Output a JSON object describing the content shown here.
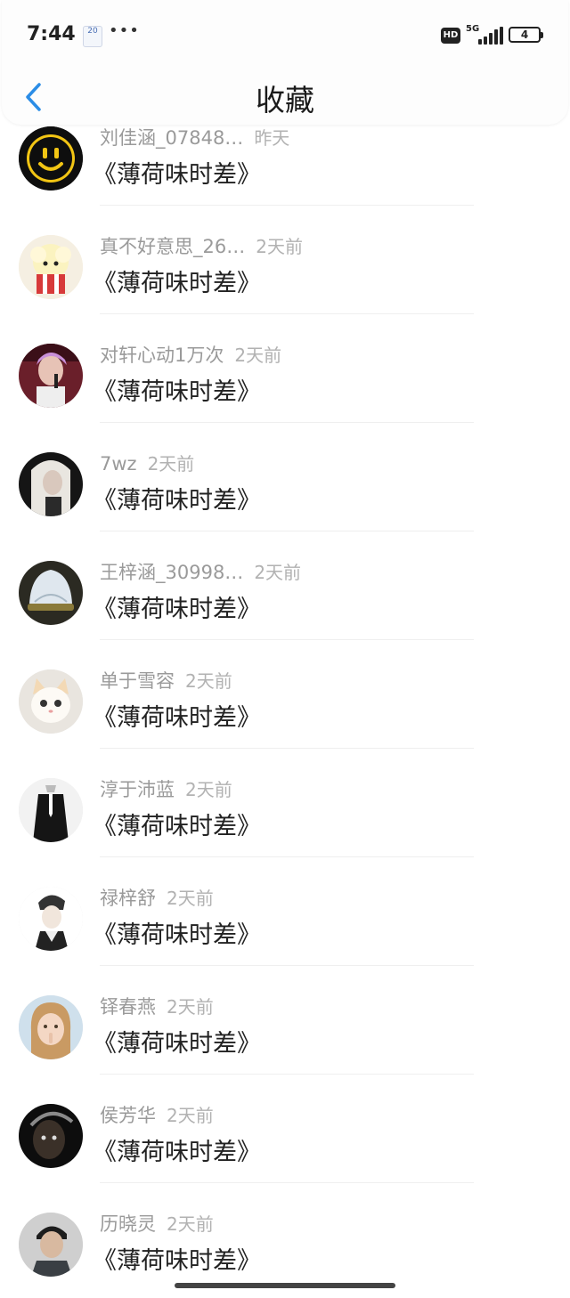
{
  "status_bar": {
    "time": "7:44",
    "date_badge": "20",
    "more": "•••",
    "hd": "HD",
    "network": "5G",
    "battery": "4"
  },
  "nav": {
    "back_icon": "chevron-left-icon",
    "title": "收藏",
    "accent_color": "#2b8de6"
  },
  "list": {
    "items": [
      {
        "name": "刘佳涵_07848…",
        "time": "昨天",
        "book": "《薄荷味时差》",
        "avatar": "smiley-face"
      },
      {
        "name": "真不好意思_26…",
        "time": "2天前",
        "book": "《薄荷味时差》",
        "avatar": "popcorn-cartoon"
      },
      {
        "name": "对轩心动1万次",
        "time": "2天前",
        "book": "《薄荷味时差》",
        "avatar": "singer-photo"
      },
      {
        "name": "7wz",
        "time": "2天前",
        "book": "《薄荷味时差》",
        "avatar": "girl-photo"
      },
      {
        "name": "王梓涵_30998…",
        "time": "2天前",
        "book": "《薄荷味时差》",
        "avatar": "crystal-object"
      },
      {
        "name": "单于雪容",
        "time": "2天前",
        "book": "《薄荷味时差》",
        "avatar": "kitten"
      },
      {
        "name": "淳于沛蓝",
        "time": "2天前",
        "book": "《薄荷味时差》",
        "avatar": "suit-figure"
      },
      {
        "name": "禄梓舒",
        "time": "2天前",
        "book": "《薄荷味时差》",
        "avatar": "sketch-figure"
      },
      {
        "name": "铎春燕",
        "time": "2天前",
        "book": "《薄荷味时差》",
        "avatar": "child-photo"
      },
      {
        "name": "侯芳华",
        "time": "2天前",
        "book": "《薄荷味时差》",
        "avatar": "dark-portrait"
      },
      {
        "name": "历晓灵",
        "time": "2天前",
        "book": "《薄荷味时差》",
        "avatar": "boy-photo"
      }
    ]
  }
}
